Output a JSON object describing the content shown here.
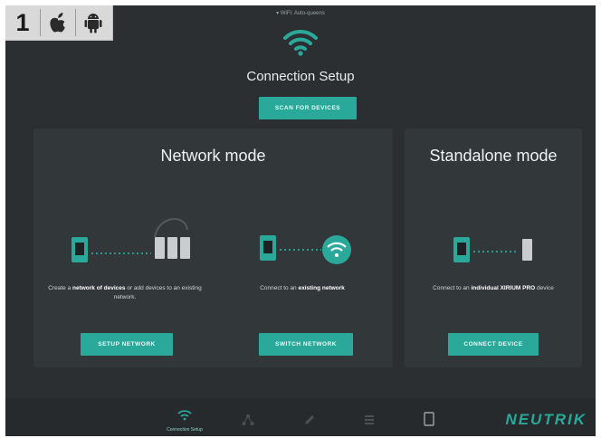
{
  "badge": {
    "number": "1",
    "platforms": [
      "apple-icon",
      "android-icon"
    ]
  },
  "status": {
    "wifi_text": "WiFi: Auto-queens"
  },
  "header": {
    "title": "Connection Setup",
    "scan_label": "SCAN FOR DEVICES"
  },
  "network_mode": {
    "title": "Network mode",
    "setup": {
      "desc_pre": "Create a ",
      "desc_bold": "network of devices",
      "desc_post": " or add devices to an existing network.",
      "button": "SETUP NETWORK"
    },
    "switch": {
      "desc_pre": "Connect to an ",
      "desc_bold": "existing network",
      "button": "SWITCH NETWORK"
    }
  },
  "standalone_mode": {
    "title": "Standalone mode",
    "desc_pre": "Connect to an ",
    "desc_bold": "individual XIRIUM PRO",
    "desc_post": " device",
    "button": "CONNECT DEVICE"
  },
  "bottom_nav": {
    "items": [
      {
        "label": "Connection Setup",
        "icon": "wifi-icon",
        "active": true
      },
      {
        "label": "",
        "icon": "network-icon",
        "active": false
      },
      {
        "label": "",
        "icon": "edit-icon",
        "active": false
      },
      {
        "label": "",
        "icon": "list-icon",
        "active": false
      },
      {
        "label": "",
        "icon": "device-icon",
        "active": false
      }
    ],
    "brand": "NEUTRIK"
  },
  "colors": {
    "accent": "#2aa99b",
    "background": "#2b2f32",
    "panel": "#323739"
  }
}
